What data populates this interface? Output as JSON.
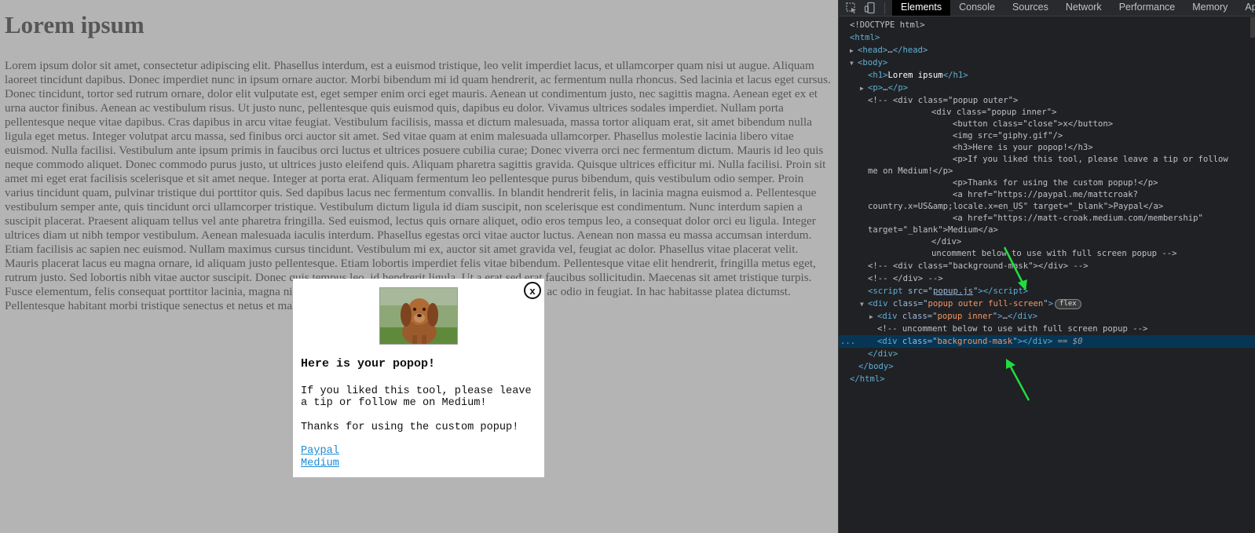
{
  "page": {
    "title": "Lorem ipsum",
    "paragraph": "Lorem ipsum dolor sit amet, consectetur adipiscing elit. Phasellus interdum, est a euismod tristique, leo velit imperdiet lacus, et ullamcorper quam nisi ut augue. Aliquam laoreet tincidunt dapibus. Donec imperdiet nunc in ipsum ornare auctor. Morbi bibendum mi id quam hendrerit, ac fermentum nulla rhoncus. Sed lacinia et lacus eget cursus. Donec tincidunt, tortor sed rutrum ornare, dolor elit vulputate est, eget semper enim orci eget mauris. Aenean ut condimentum justo, nec sagittis magna. Aenean eget ex et urna auctor finibus. Aenean ac vestibulum risus. Ut justo nunc, pellentesque quis euismod quis, dapibus eu dolor. Vivamus ultrices sodales imperdiet. Nullam porta pellentesque neque vitae dapibus. Cras dapibus in arcu vitae feugiat. Vestibulum facilisis, massa et dictum malesuada, massa tortor aliquam erat, sit amet bibendum nulla ligula eget metus. Integer volutpat arcu massa, sed finibus orci auctor sit amet. Sed vitae quam at enim malesuada ullamcorper. Phasellus molestie lacinia libero vitae euismod. Nulla facilisi. Vestibulum ante ipsum primis in faucibus orci luctus et ultrices posuere cubilia curae; Donec viverra orci nec fermentum dictum. Mauris id leo quis neque commodo aliquet. Donec commodo purus justo, ut ultrices justo eleifend quis. Aliquam pharetra sagittis gravida. Quisque ultrices efficitur mi. Nulla facilisi. Proin sit amet mi eget erat facilisis scelerisque et sit amet neque. Integer at porta erat. Aliquam fermentum leo pellentesque purus bibendum, quis vestibulum odio semper. Proin varius tincidunt quam, pulvinar tristique dui porttitor quis. Sed dapibus lacus nec fermentum convallis. In blandit hendrerit felis, in lacinia magna euismod a. Pellentesque vestibulum semper ante, quis tincidunt orci ullamcorper tristique. Vestibulum dictum ligula id diam suscipit, non scelerisque est condimentum. Nunc interdum sapien a suscipit placerat. Praesent aliquam tellus vel ante pharetra fringilla. Sed euismod, lectus quis ornare aliquet, odio eros tempus leo, a consequat dolor orci eu ligula. Integer ultrices diam ut nibh tempor vestibulum. Aenean malesuada iaculis interdum. Phasellus egestas orci vitae auctor luctus. Aenean non massa eu massa accumsan interdum. Etiam facilisis ac sapien nec euismod. Nullam maximus cursus tincidunt. Vestibulum mi ex, auctor sit amet gravida vel, feugiat ac dolor. Phasellus vitae placerat velit. Mauris placerat lacus eu magna ornare, id aliquam justo pellentesque. Etiam lobortis imperdiet felis vitae bibendum. Pellentesque vitae elit hendrerit, fringilla metus eget, rutrum justo. Sed lobortis nibh vitae auctor suscipit. Donec quis tempus leo, id hendrerit ligula. Ut a erat sed erat faucibus sollicitudin. Maecenas sit amet tristique turpis. Fusce elementum, felis consequat porttitor lacinia, magna nibh pulvinar est, id venenatis sapien augue in dapibus ac odio in feugiat. In hac habitasse platea dictumst. Pellentesque habitant morbi tristique senectus et netus et malesuada fames ac turpis egestas."
  },
  "popup": {
    "close_label": "x",
    "image_icon": "dog-photo",
    "heading": "Here is your popop!",
    "message1": "If you liked this tool, please leave a tip or follow me on Medium!",
    "message2": "Thanks for using the custom popup!",
    "link_paypal": "Paypal",
    "link_medium": "Medium"
  },
  "devtools": {
    "tabs": [
      "Elements",
      "Console",
      "Sources",
      "Network",
      "Performance",
      "Memory",
      "Ap"
    ],
    "active_tab": "Elements",
    "tree": {
      "doctype": "<!DOCTYPE html>",
      "html_open": "html",
      "head": "head",
      "body": "body",
      "h1_text": "Lorem ipsum",
      "p": "p",
      "cmt1": "<!-- <div class=\"popup outer\">",
      "cmt2": "<div class=\"popup inner\">",
      "cmt3": "<button class=\"close\">x</button>",
      "cmt4": "<img src=\"giphy.gif\"/>",
      "cmt5": "<h3>Here is your popop!</h3>",
      "cmt6a": "<p>If you liked this tool, please leave a tip or follow",
      "cmt6b": "me on Medium!</p>",
      "cmt7": "<p>Thanks for using the custom popup!</p>",
      "cmt8a": "<a href=\"https://paypal.me/mattcroak?",
      "cmt8b": "country.x=US&amp;locale.x=en_US\" target=\"_blank\">Paypal</a>",
      "cmt9a": "<a href=\"https://matt-croak.medium.com/membership\"",
      "cmt9b": "target=\"_blank\">Medium</a>",
      "cmt10": "</div>",
      "cmt11": "uncomment below to use with full screen popup -->",
      "cmt12": "<!-- <div class=\"background-mask\"></div> -->",
      "cmt13": "<!-- </div> -->",
      "script_attr": "src",
      "script_src": "popup.js",
      "div_attr": "class",
      "div_outer_class": "popup outer full-screen",
      "flex_badge": "flex",
      "div_inner_class": "popup inner",
      "cmt14": "<!-- uncomment below to use with full screen popup -->",
      "div_mask_class": "background-mask",
      "selected_marker": "== $0",
      "dots": "..."
    }
  },
  "colors": {
    "page_bg": "#b4b4b4",
    "devtools_bg": "#202124",
    "selected_row": "#073655",
    "arrow": "#22dd3d",
    "link": "#1a8bd6"
  }
}
